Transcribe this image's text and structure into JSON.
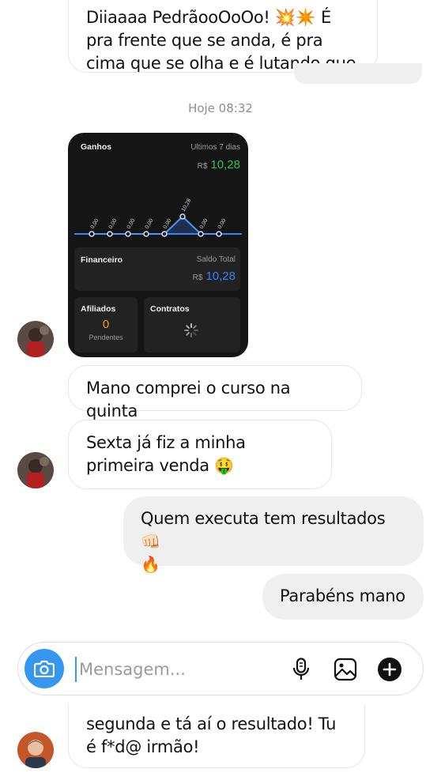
{
  "thread": {
    "top_message": "Diiaaaa PedrãooOoOo! 💥✴️ É pra frente que se anda, é pra cima que se olha e é lutando que se",
    "timestamp": "Hoje 08:32",
    "dashboard": {
      "earnings_title": "Ganhos",
      "period": "Ultimos 7 dias",
      "currency": "R$",
      "earnings_value": "10,28",
      "chart_labels": [
        "0,00",
        "0,00",
        "0,00",
        "0,00",
        "0,00",
        "10,28",
        "0,00",
        "0,00"
      ],
      "finance_title": "Financeiro",
      "balance_label": "Saldo Total",
      "balance_value": "10,28",
      "affiliates_title": "Afiliados",
      "affiliates_count": "0",
      "affiliates_status": "Pendentes",
      "contracts_title": "Contratos",
      "accent_green": "#22c55e",
      "accent_blue": "#3b82f6"
    },
    "messages": [
      {
        "id": "msg1",
        "direction": "incoming",
        "text": "Mano comprei o curso na quinta"
      },
      {
        "id": "msg2",
        "direction": "incoming",
        "text": "Sexta já fiz a minha primeira venda",
        "emoji": "🤑"
      },
      {
        "id": "msg3",
        "direction": "outgoing",
        "text": "Quem executa tem resultados",
        "emoji": "👊🏻",
        "emoji2": "🔥"
      },
      {
        "id": "msg4",
        "direction": "outgoing",
        "text": "Parabéns mano"
      }
    ],
    "bottom_message": "segunda e tá aí o resultado! Tu é f*d@ irmão!"
  },
  "composer": {
    "placeholder": "Mensagem...",
    "camera_icon": "camera-icon",
    "mic_icon": "microphone-icon",
    "gallery_icon": "gallery-icon",
    "add_icon": "plus-circle-icon",
    "accent": "#3797f0"
  }
}
